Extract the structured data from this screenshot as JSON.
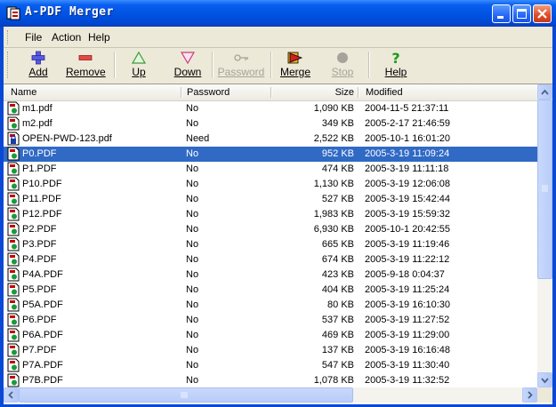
{
  "window": {
    "title": "A-PDF Merger"
  },
  "menu": {
    "file": "File",
    "action": "Action",
    "help": "Help"
  },
  "toolbar": {
    "add": "Add",
    "remove": "Remove",
    "up": "Up",
    "down": "Down",
    "password": "Password",
    "merge": "Merge",
    "stop": "Stop",
    "help": "Help"
  },
  "columns": {
    "name": "Name",
    "password": "Password",
    "size": "Size",
    "modified": "Modified"
  },
  "files": [
    {
      "name": "m1.pdf",
      "password": "No",
      "size": "1,090 KB",
      "modified": "2004-11-5 21:37:11"
    },
    {
      "name": "m2.pdf",
      "password": "No",
      "size": "349 KB",
      "modified": "2005-2-17 21:46:59"
    },
    {
      "name": "OPEN-PWD-123.pdf",
      "password": "Need",
      "size": "2,522 KB",
      "modified": "2005-10-1 16:01:20"
    },
    {
      "name": "P0.PDF",
      "password": "No",
      "size": "952 KB",
      "modified": "2005-3-19 11:09:24",
      "selected": true
    },
    {
      "name": "P1.PDF",
      "password": "No",
      "size": "474 KB",
      "modified": "2005-3-19 11:11:18"
    },
    {
      "name": "P10.PDF",
      "password": "No",
      "size": "1,130 KB",
      "modified": "2005-3-19 12:06:08"
    },
    {
      "name": "P11.PDF",
      "password": "No",
      "size": "527 KB",
      "modified": "2005-3-19 15:42:44"
    },
    {
      "name": "P12.PDF",
      "password": "No",
      "size": "1,983 KB",
      "modified": "2005-3-19 15:59:32"
    },
    {
      "name": "P2.PDF",
      "password": "No",
      "size": "6,930 KB",
      "modified": "2005-10-1 20:42:55"
    },
    {
      "name": "P3.PDF",
      "password": "No",
      "size": "665 KB",
      "modified": "2005-3-19 11:19:46"
    },
    {
      "name": "P4.PDF",
      "password": "No",
      "size": "674 KB",
      "modified": "2005-3-19 11:22:12"
    },
    {
      "name": "P4A.PDF",
      "password": "No",
      "size": "423 KB",
      "modified": "2005-9-18 0:04:37"
    },
    {
      "name": "P5.PDF",
      "password": "No",
      "size": "404 KB",
      "modified": "2005-3-19 11:25:24"
    },
    {
      "name": "P5A.PDF",
      "password": "No",
      "size": "80 KB",
      "modified": "2005-3-19 16:10:30"
    },
    {
      "name": "P6.PDF",
      "password": "No",
      "size": "537 KB",
      "modified": "2005-3-19 11:27:52"
    },
    {
      "name": "P6A.PDF",
      "password": "No",
      "size": "469 KB",
      "modified": "2005-3-19 11:29:00"
    },
    {
      "name": "P7.PDF",
      "password": "No",
      "size": "137 KB",
      "modified": "2005-3-19 16:16:48"
    },
    {
      "name": "P7A.PDF",
      "password": "No",
      "size": "547 KB",
      "modified": "2005-3-19 11:30:40"
    },
    {
      "name": "P7B.PDF",
      "password": "No",
      "size": "1,078 KB",
      "modified": "2005-3-19 11:32:52"
    }
  ],
  "colors": {
    "selection": "#316ac5",
    "titlebar": "#0054e3",
    "chrome": "#ece9d8"
  }
}
